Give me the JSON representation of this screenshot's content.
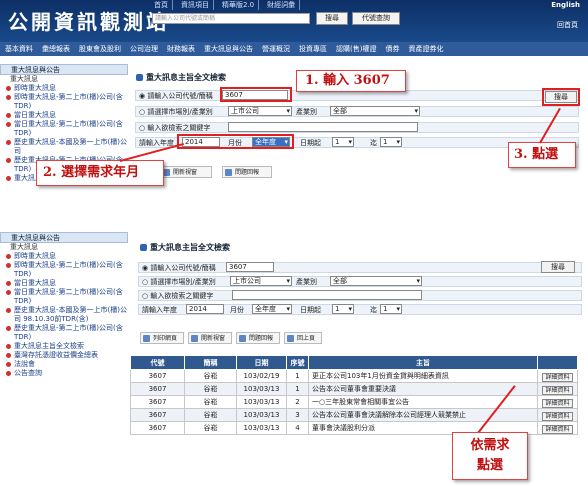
{
  "header": {
    "logo": "公開資訊觀測站",
    "links": [
      "首頁",
      "資訊項目",
      "精華版2.0",
      "財經詞彙"
    ],
    "search_placeholder": "請輸入公司代號或簡稱",
    "search_btn": "搜尋",
    "code_btn": "代號查詢",
    "english": "English",
    "home": "回首頁"
  },
  "nav": [
    "基本資料",
    "彙總報表",
    "股東會及股利",
    "公司治理",
    "財務報表",
    "重大訊息與公告",
    "營運概況",
    "投資專區",
    "認購(售)權證",
    "債券",
    "資產證券化"
  ],
  "sidebar1": {
    "title": "重大訊息與公告",
    "cat": "重大訊息",
    "items": [
      "即時重大訊息",
      "即時重大訊息-第二上市(櫃)公司(含TDR)",
      "當日重大訊息",
      "當日重大訊息-第二上市(櫃)公司(含TDR)",
      "歷史重大訊息-本國及第一上市(櫃)公司",
      "歷史重大訊息-第二上市(櫃)公司(含TDR)",
      "重大訊息主旨全文檢索"
    ]
  },
  "sidebar2": {
    "title": "重大訊息與公告",
    "cat": "重大訊息",
    "items": [
      "即時重大訊息",
      "即時重大訊息-第二上市(櫃)公司(含TDR)",
      "當日重大訊息",
      "當日重大訊息-第二上市(櫃)公司(含TDR)",
      "歷史重大訊息-本國及第一上市(櫃)公司 98.10.30前TDR(含)",
      "歷史重大訊息-第二上市(櫃)公司(含TDR)",
      "重大訊息主旨全文檢索",
      "臺灣存託憑證收益價金總表",
      "法說會",
      "公告查詢"
    ]
  },
  "form": {
    "title": "重大訊息主旨全文檢索",
    "code_label": "請輸入公司代號/簡稱",
    "code_value": "3607",
    "market_label": "請選擇市場別/產業別",
    "market_value": "上市公司",
    "industry_label": "產業別",
    "industry_value": "全部",
    "keyword_label": "輸入欲檢索之關鍵字",
    "year_label": "請輸入年度",
    "year_value": "2014",
    "month_label": "月份",
    "month_value": "全年度",
    "day_from_label": "日期起",
    "day_from": "1",
    "day_to_label": "迄",
    "day_to": "1",
    "search_btn": "搜尋"
  },
  "tools1": [
    "開新視窗",
    "問題回報"
  ],
  "tools2": [
    "列印網頁",
    "開新視窗",
    "問題回報",
    "回上頁"
  ],
  "table": {
    "headers": [
      "代號",
      "簡稱",
      "日期",
      "序號",
      "主旨",
      ""
    ],
    "detail_btn": "詳細資料",
    "rows": [
      [
        "3607",
        "谷崧",
        "103/02/19",
        "1",
        "更正本公司103年1月份資金貸與明細表資訊"
      ],
      [
        "3607",
        "谷崧",
        "103/03/13",
        "1",
        "公告本公司董事會重要決議"
      ],
      [
        "3607",
        "谷崧",
        "103/03/13",
        "2",
        "一○三年股東常會相關事宜公告"
      ],
      [
        "3607",
        "谷崧",
        "103/03/13",
        "3",
        "公告本公司董事會決議解除本公司經理人競業禁止"
      ],
      [
        "3607",
        "谷崧",
        "103/03/13",
        "4",
        "董事會決議股利分派"
      ]
    ]
  },
  "callouts": {
    "step1": "1. 輸入 3607",
    "step2": "2. 選擇需求年月",
    "step3": "3. 點選",
    "step4a": "依需求",
    "step4b": "點選"
  }
}
